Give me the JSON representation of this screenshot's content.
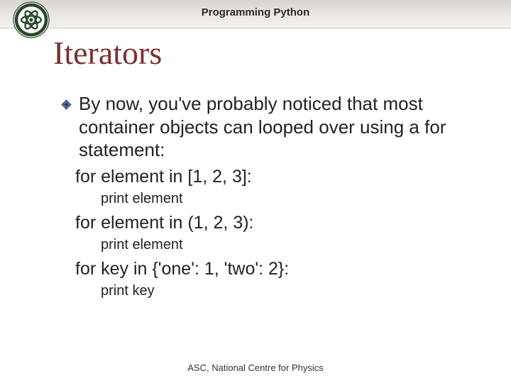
{
  "header": {
    "title": "Programming Python"
  },
  "title": "Iterators",
  "main_bullet": "By now, you've probably noticed that most container objects can looped over using a for statement:",
  "code": {
    "l1": "for element in [1, 2, 3]:",
    "s1": "print element",
    "l2": "for element in (1, 2, 3):",
    "s2": "print element",
    "l3": "for key in {'one': 1, 'two': 2}:",
    "s3": "print key"
  },
  "footer": "ASC, National Centre for Physics"
}
